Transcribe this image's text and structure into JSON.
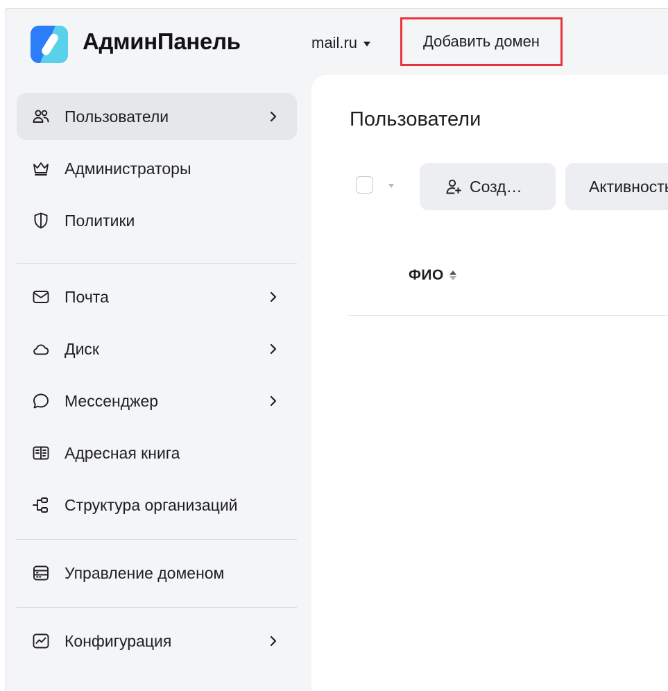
{
  "header": {
    "brand": "АдминПанель",
    "domain": "mail.ru",
    "add_domain": "Добавить домен"
  },
  "sidebar": {
    "items": [
      {
        "label": "Пользователи",
        "icon": "users-icon",
        "chevron": true,
        "active": true
      },
      {
        "label": "Администраторы",
        "icon": "crown-icon",
        "chevron": false
      },
      {
        "label": "Политики",
        "icon": "shield-icon",
        "chevron": false
      },
      {
        "label": "Почта",
        "icon": "mail-icon",
        "chevron": true
      },
      {
        "label": "Диск",
        "icon": "cloud-icon",
        "chevron": true
      },
      {
        "label": "Мессенджер",
        "icon": "chat-bubble-icon",
        "chevron": true
      },
      {
        "label": "Адресная книга",
        "icon": "book-icon",
        "chevron": false
      },
      {
        "label": "Структура организаций",
        "icon": "org-structure-icon",
        "chevron": false
      },
      {
        "label": "Управление доменом",
        "icon": "server-icon",
        "chevron": false
      },
      {
        "label": "Конфигурация",
        "icon": "chart-icon",
        "chevron": true
      }
    ]
  },
  "main": {
    "title": "Пользователи",
    "create_button": "Созд…",
    "activity_button": "Активность",
    "column_fio": "ФИО"
  },
  "colors": {
    "accent_blue": "#2b7df8",
    "accent_cyan": "#5ad1ea",
    "highlight_border": "#e8333a",
    "sidebar_bg": "#f4f5f7",
    "active_item_bg": "#e6e7ea"
  }
}
